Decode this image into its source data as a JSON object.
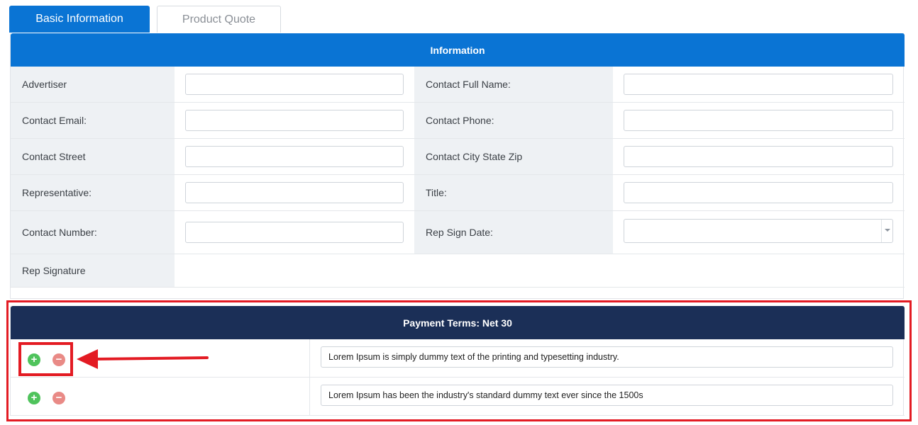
{
  "tabs": [
    {
      "label": "Basic Information",
      "active": true
    },
    {
      "label": "Product Quote",
      "active": false
    }
  ],
  "info": {
    "header": "Information",
    "rows": [
      {
        "left_label": "Advertiser",
        "left_value": "",
        "right_label": "Contact Full Name:",
        "right_value": ""
      },
      {
        "left_label": "Contact Email:",
        "left_value": "",
        "right_label": "Contact Phone:",
        "right_value": ""
      },
      {
        "left_label": "Contact Street",
        "left_value": "",
        "right_label": "Contact City State Zip",
        "right_value": ""
      },
      {
        "left_label": "Representative:",
        "left_value": "",
        "right_label": "Title:",
        "right_value": ""
      },
      {
        "left_label": "Contact Number:",
        "left_value": "",
        "right_label": "Rep Sign Date:",
        "right_value": ""
      }
    ],
    "signature_label": "Rep Signature"
  },
  "payment": {
    "header": "Payment Terms: Net 30",
    "rows": [
      {
        "text": "Lorem Ipsum is simply dummy text of the printing and typesetting industry."
      },
      {
        "text": "Lorem Ipsum has been the industry's standard dummy text ever since the 1500s"
      }
    ],
    "add_symbol": "+",
    "remove_symbol": "−"
  },
  "colors": {
    "primary": "#0a74d4",
    "navy": "#1b2f57",
    "annotation": "#e31b23",
    "add": "#4fc35c",
    "remove": "#e98a86"
  }
}
